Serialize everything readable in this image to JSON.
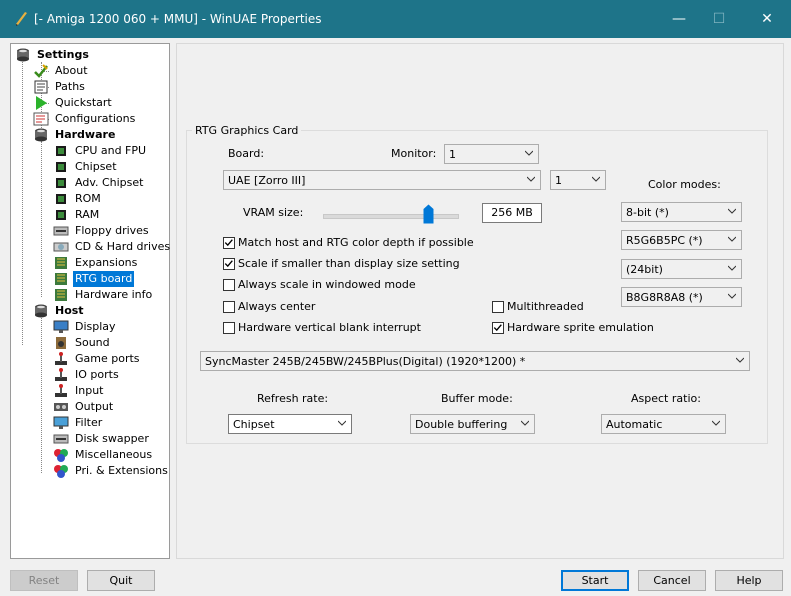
{
  "window": {
    "title": "[- Amiga 1200 060 + MMU] - WinUAE Properties",
    "controls": {
      "minimize": "—",
      "maximize": "☐",
      "close": "✕"
    }
  },
  "tree": {
    "settings": "Settings",
    "about": "About",
    "paths": "Paths",
    "quickstart": "Quickstart",
    "configurations": "Configurations",
    "hardware": "Hardware",
    "cpu": "CPU and FPU",
    "chipset": "Chipset",
    "adv_chipset": "Adv. Chipset",
    "rom": "ROM",
    "ram": "RAM",
    "floppy": "Floppy drives",
    "cd": "CD & Hard drives",
    "expansions": "Expansions",
    "rtg": "RTG board",
    "hwinfo": "Hardware info",
    "host": "Host",
    "display": "Display",
    "sound": "Sound",
    "gameports": "Game ports",
    "ioports": "IO ports",
    "input": "Input",
    "output": "Output",
    "filter": "Filter",
    "diskswapper": "Disk swapper",
    "misc": "Miscellaneous",
    "pri": "Pri. & Extensions"
  },
  "rtg": {
    "group_title": "RTG Graphics Card",
    "board_label": "Board:",
    "monitor_label": "Monitor:",
    "monitor_value": "1",
    "board_value": "UAE [Zorro III]",
    "board_index": "1",
    "vram_label": "VRAM size:",
    "vram_value": "256 MB",
    "vram_level": 0.78,
    "color_modes_label": "Color modes:",
    "color_modes": [
      "8-bit (*)",
      "R5G6B5PC (*)",
      "(24bit)",
      "B8G8R8A8 (*)"
    ],
    "checks": {
      "match_host": {
        "label": "Match host and RTG color depth if possible",
        "checked": true
      },
      "scale_smaller": {
        "label": "Scale if smaller than display size setting",
        "checked": true
      },
      "always_scale": {
        "label": "Always scale in windowed mode",
        "checked": false
      },
      "always_center": {
        "label": "Always center",
        "checked": false
      },
      "hw_vblank": {
        "label": "Hardware vertical blank interrupt",
        "checked": false
      },
      "multithreaded": {
        "label": "Multithreaded",
        "checked": false
      },
      "hw_sprite": {
        "label": "Hardware sprite emulation",
        "checked": true
      }
    },
    "display_value": "SyncMaster 245B/245BW/245BPlus(Digital) (1920*1200) *",
    "refresh_label": "Refresh rate:",
    "refresh_value": "Chipset",
    "buffer_label": "Buffer mode:",
    "buffer_value": "Double buffering",
    "aspect_label": "Aspect ratio:",
    "aspect_value": "Automatic"
  },
  "buttons": {
    "reset": "Reset",
    "quit": "Quit",
    "start": "Start",
    "cancel": "Cancel",
    "help": "Help"
  }
}
